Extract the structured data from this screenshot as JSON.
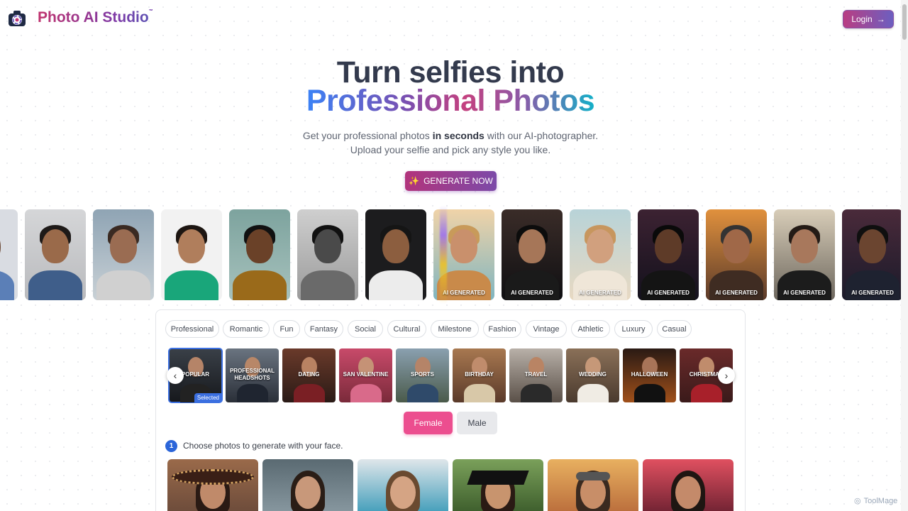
{
  "header": {
    "brand": "Photo AI Studio",
    "brand_mark": "™",
    "login_label": "Login"
  },
  "hero": {
    "title_line1": "Turn selfies into",
    "title_line2": "Professional Photos",
    "subtitle_pre": "Get your professional photos ",
    "subtitle_bold": "in seconds",
    "subtitle_post": " with our AI-photographer.",
    "subtitle_line2": "Upload your selfie and pick any style you like.",
    "cta_label": "GENERATE NOW"
  },
  "strip": {
    "ai_label": "AI GENERATED"
  },
  "style_tabs": [
    "Professional",
    "Romantic",
    "Fun",
    "Fantasy",
    "Social",
    "Cultural",
    "Milestone",
    "Fashion",
    "Vintage",
    "Athletic",
    "Luxury",
    "Casual"
  ],
  "categories": [
    {
      "label": "POPULAR",
      "selected": true
    },
    {
      "label": "PROFESSIONAL HEADSHOTS"
    },
    {
      "label": "DATING"
    },
    {
      "label": "SAN VALENTINE"
    },
    {
      "label": "SPORTS"
    },
    {
      "label": "BIRTHDAY"
    },
    {
      "label": "TRAVEL"
    },
    {
      "label": "WEDDING"
    },
    {
      "label": "HALLOWEEN"
    },
    {
      "label": "CHRISTMAS"
    }
  ],
  "selected_badge": "Selected",
  "gender": {
    "female": "Female",
    "male": "Male"
  },
  "step": {
    "number": "1",
    "text": "Choose photos to generate with your face."
  },
  "watermark": "ToolMage",
  "colors": {
    "accent_pink": "#ec4e8f",
    "accent_purple": "#7c3aa8",
    "accent_blue": "#2b65d9"
  }
}
